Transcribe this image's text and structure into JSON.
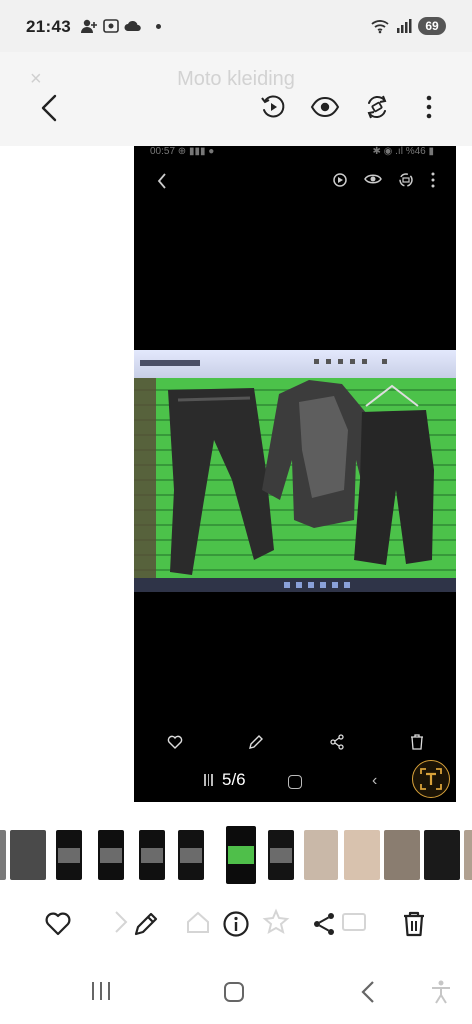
{
  "status_bar": {
    "time": "21:43",
    "battery": "69",
    "icons": [
      "person-add-icon",
      "screenshot-icon",
      "cloud-icon",
      "dot-icon",
      "wifi-icon",
      "signal-icon"
    ]
  },
  "app_bar": {
    "faded_title": "Moto kleiding",
    "faded_close": "×",
    "actions": [
      "motion-photo-icon",
      "eye-icon",
      "rotate-icon",
      "more-options-icon"
    ]
  },
  "photo": {
    "inner_status_left": "00:57  ⊕ ▮▮▮ ●",
    "inner_status_right": "✱ ◉ .ıl %46 ▮",
    "inner_counter": "5/6",
    "text_recognition_label": "T"
  },
  "thumbnails": [
    {
      "name": "thumb-1",
      "color": "#7a7a7a"
    },
    {
      "name": "thumb-2",
      "color": "#4a4a4a"
    },
    {
      "name": "thumb-3",
      "color": "#111111"
    },
    {
      "name": "thumb-4",
      "color": "#0f0f0f"
    },
    {
      "name": "thumb-5",
      "color": "#101010"
    },
    {
      "name": "thumb-6",
      "color": "#121212"
    },
    {
      "name": "thumb-7",
      "color": "#0c0c0c"
    },
    {
      "name": "thumb-8",
      "color": "#141414"
    },
    {
      "name": "thumb-9",
      "color": "#c9b8a8"
    },
    {
      "name": "thumb-10",
      "color": "#d8c2ae"
    },
    {
      "name": "thumb-11",
      "color": "#8a7d70"
    },
    {
      "name": "thumb-12",
      "color": "#1a1a1a"
    },
    {
      "name": "thumb-13",
      "color": "#b0a090"
    }
  ],
  "colors": {
    "accent_gold": "#d9a23a",
    "wall_green": "#4fbf4a"
  }
}
